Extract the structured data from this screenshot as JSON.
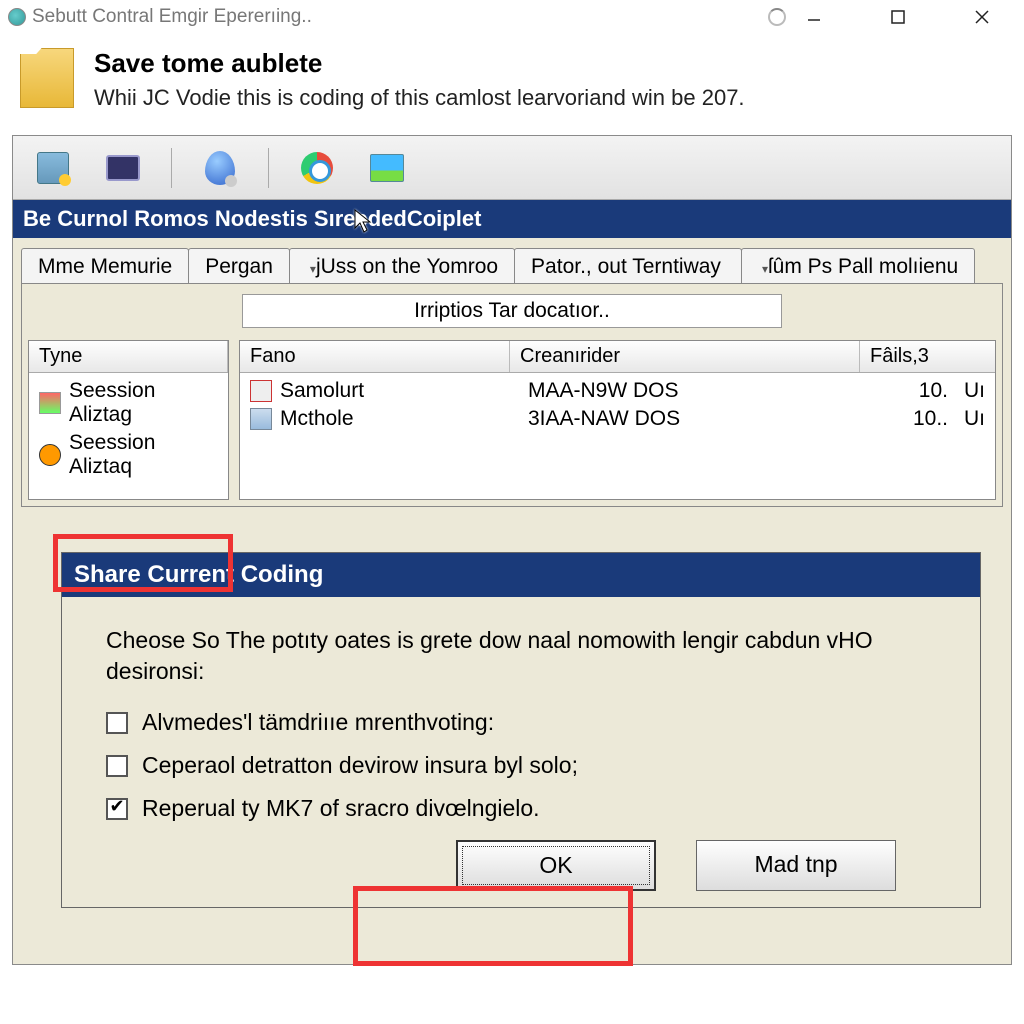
{
  "window": {
    "title": "Sebutt Contral Emgir Epererıing.."
  },
  "banner": {
    "heading": "Save tome aublete",
    "sub": "Whii JC Vodie this is coding of this camlost learvoriand win be 207."
  },
  "section_bar": "Be Curnol Romos Nodestis SıreededCoiplet",
  "tabs": [
    {
      "label": "Mme Memurie"
    },
    {
      "label": "Pergan"
    },
    {
      "label": "jUss on the Yomroo",
      "dropdown": true
    },
    {
      "label": "Pator., out Terntiway"
    },
    {
      "label": "ſûm Ps Pall molıienu",
      "dropdown": true
    }
  ],
  "subheader": "Irriptios Tar docatıor..",
  "left_list": {
    "header": "Tyne",
    "rows": [
      {
        "icon": "a",
        "text": "Seession Aliztag"
      },
      {
        "icon": "b",
        "text": "Seession Aliztaq"
      }
    ]
  },
  "right_list": {
    "cols": [
      "Fano",
      "Creanırider",
      "Fâils,3"
    ],
    "rows": [
      {
        "icon": "c",
        "c1": "Samolurt",
        "c2": "MAA-N9W DOS",
        "c3": "10.",
        "c4": "Uı"
      },
      {
        "icon": "d",
        "c1": "Mcthole",
        "c2": "3IAA-NAW DOS",
        "c3": "10..",
        "c4": "Uı"
      }
    ]
  },
  "dialog": {
    "title": "Share Current Coding",
    "text": "Cheose So The potıty oates is grete dow naal nomowith lengir cabdun vHO desironsi:",
    "opts": [
      {
        "checked": false,
        "label": "Alvmedes'l tämdriııe mrenthvoting:"
      },
      {
        "checked": false,
        "label": "Ceperaol detratton devirow insura byl solo;"
      },
      {
        "checked": true,
        "label": "Reperual ty MK7 of sracro divœlngielo."
      }
    ],
    "ok": "OK",
    "other": "Mad tnp"
  }
}
